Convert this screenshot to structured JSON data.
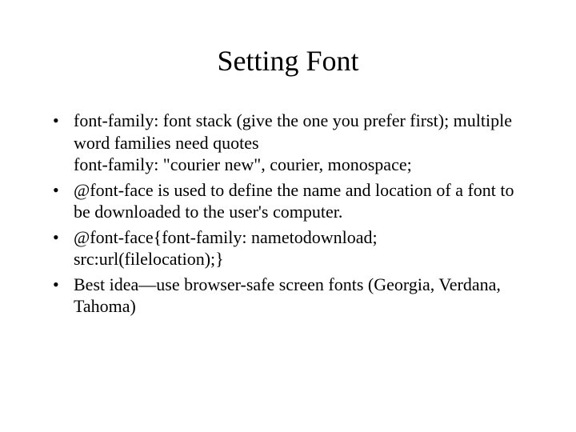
{
  "slide": {
    "title": "Setting Font",
    "bullets": [
      " font-family:  font stack (give the one you prefer first); multiple word families need quotes\nfont-family: \"courier new\", courier, monospace;",
      "@font-face is used to define the name and location of a font to be downloaded to the user's computer.",
      "@font-face{font-family: nametodownload; src:url(filelocation);}",
      "Best idea—use browser-safe screen fonts (Georgia, Verdana, Tahoma)"
    ]
  }
}
